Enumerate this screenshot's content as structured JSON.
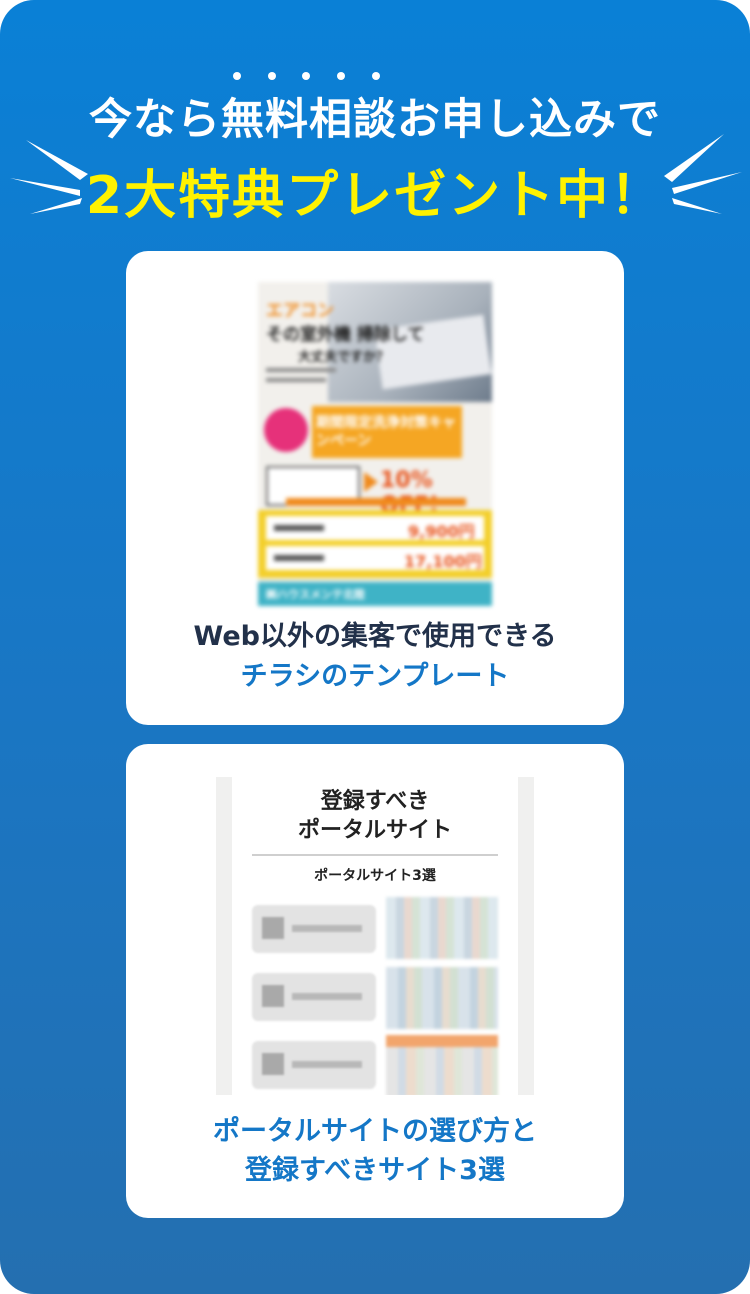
{
  "header": {
    "line1": "今なら無料相談お申し込みで",
    "line2": "2大特典プレゼント中！"
  },
  "benefits": [
    {
      "caption_line1": "Web以外の集客で使用できる",
      "caption_line2": "チラシのテンプレート",
      "flyer": {
        "title_top": "エアコン",
        "title_mid": "その室外機 掃除して",
        "title_mid2": "大丈夫ですか？",
        "campaign": "期間限定洗浄対策キャンペーン",
        "badge": "10% OFF!",
        "price1": "9,900円",
        "price2": "17,100円",
        "footer": "㈱ハウスメンテ北陸"
      }
    },
    {
      "caption_line1": "ポータルサイトの選び方と",
      "caption_line2": "登録すべきサイト3選",
      "portal": {
        "title_line1": "登録すべき",
        "title_line2": "ポータルサイト",
        "subtitle": "ポータルサイト3選"
      }
    }
  ],
  "colors": {
    "background_top": "#0a80d6",
    "background_bottom": "#246fb0",
    "highlight_yellow": "#fff200",
    "caption_blue": "#1477c7",
    "caption_dark": "#22314a"
  }
}
